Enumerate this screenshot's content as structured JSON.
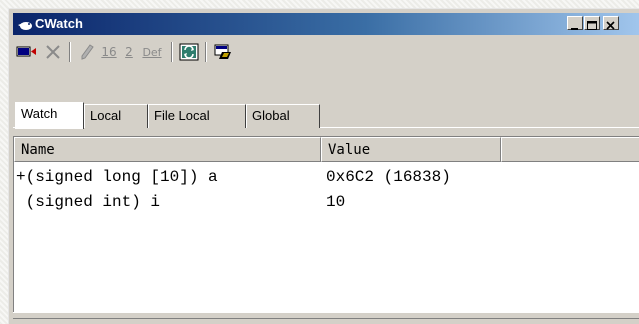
{
  "window": {
    "title": "CWatch",
    "controls": {
      "minimize": "_",
      "maximize": "□",
      "close": "×"
    }
  },
  "toolbar": {
    "buttons": [
      {
        "name": "add-watch",
        "icon": "add-watch-icon",
        "enabled": true
      },
      {
        "name": "delete",
        "icon": "delete-x-icon",
        "enabled": false
      },
      {
        "name": "edit-value",
        "icon": "pencil-icon",
        "enabled": false
      },
      {
        "name": "radix-hex",
        "label": "16",
        "enabled": false
      },
      {
        "name": "radix-bin",
        "label": "2",
        "enabled": false
      },
      {
        "name": "radix-default",
        "label": "Def",
        "enabled": false
      },
      {
        "name": "refresh",
        "icon": "refresh-icon",
        "enabled": true
      },
      {
        "name": "settings",
        "icon": "setting-icon",
        "enabled": true
      }
    ]
  },
  "tabs": [
    {
      "label": "Watch",
      "active": true
    },
    {
      "label": "Local",
      "active": false
    },
    {
      "label": "File Local",
      "active": false
    },
    {
      "label": "Global",
      "active": false
    }
  ],
  "table": {
    "columns": [
      "Name",
      "Value",
      ""
    ],
    "rows": [
      {
        "name": "+(signed long [10]) a",
        "value": "0x6C2 (16838)"
      },
      {
        "name": " (signed int) i",
        "value": "10"
      }
    ]
  },
  "colors": {
    "title_gradient_start": "#0a246a",
    "title_gradient_end": "#a6caf0",
    "face": "#d4d0c8",
    "list_background": "#ffffff"
  }
}
